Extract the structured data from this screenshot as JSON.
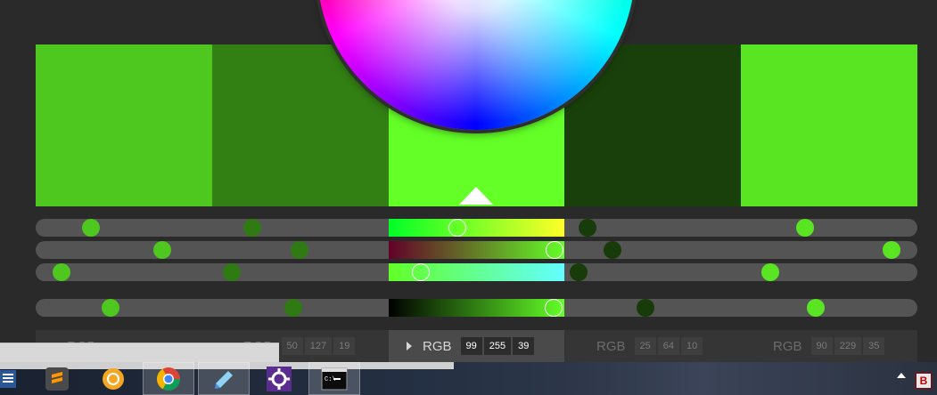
{
  "swatches": [
    {
      "color": "#4ec71e"
    },
    {
      "color": "#327f13"
    },
    {
      "color": "#63ff27"
    },
    {
      "color": "#19400a"
    },
    {
      "color": "#5ae523"
    }
  ],
  "active_swatch_index": 2,
  "sliders": {
    "row1": {
      "active_gradient": "linear-gradient(90deg,#00ff27,#ffff27)"
    },
    "row2": {
      "active_gradient": "linear-gradient(90deg,#630027,#63ff27)"
    },
    "row3": {
      "active_gradient": "linear-gradient(90deg,#630027,#63ffff)"
    },
    "row4": {
      "active_gradient": "linear-gradient(90deg,#000000,#63ff27)"
    }
  },
  "labels": [
    {
      "mode": "RGB",
      "values": [
        "",
        "",
        ""
      ]
    },
    {
      "mode": "RGB",
      "values": [
        "50",
        "127",
        "19"
      ]
    },
    {
      "mode": "RGB",
      "values": [
        "99",
        "255",
        "39"
      ]
    },
    {
      "mode": "RGB",
      "values": [
        "25",
        "64",
        "10"
      ]
    },
    {
      "mode": "RGB",
      "values": [
        "90",
        "229",
        "35"
      ]
    }
  ],
  "taskbar": {
    "items": [
      "document-app-icon",
      "sublime-text-icon",
      "circle-app-icon",
      "chrome-icon",
      "notepad-icon",
      "settings-gear-icon",
      "terminal-icon"
    ],
    "tray": [
      "up-arrow-icon",
      "b-app-icon"
    ],
    "b_app_letter": "B"
  }
}
